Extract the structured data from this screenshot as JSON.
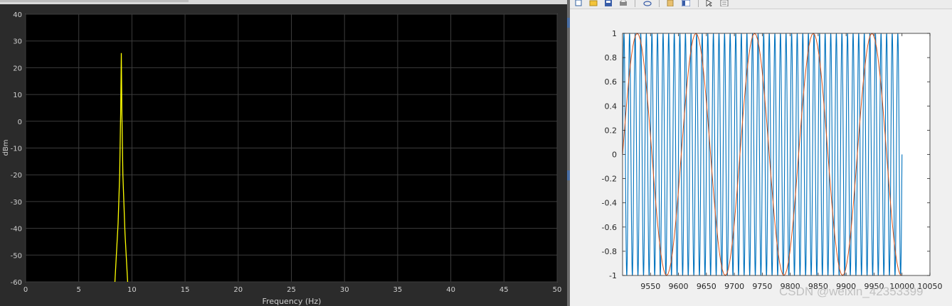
{
  "chart_data": [
    {
      "type": "line",
      "xlabel": "Frequency (Hz)",
      "ylabel": "dBm",
      "xlim": [
        0,
        50
      ],
      "ylim": [
        -60,
        40
      ],
      "xticks": [
        0,
        5,
        10,
        15,
        20,
        25,
        30,
        35,
        40,
        45,
        50
      ],
      "yticks": [
        40,
        30,
        20,
        10,
        0,
        -10,
        -20,
        -30,
        -40,
        -50,
        -60
      ],
      "grid": true,
      "background": "#000000",
      "series": [
        {
          "color": "#ffff00",
          "x": [
            8.4,
            8.7,
            8.85,
            8.95,
            9.0,
            9.05,
            9.15,
            9.35,
            9.6
          ],
          "y": [
            -60,
            -38,
            -20,
            5,
            25.5,
            5,
            -20,
            -42,
            -60
          ]
        }
      ]
    },
    {
      "type": "line",
      "xlabel": "",
      "ylabel": "",
      "xlim": [
        9500,
        10050
      ],
      "ylim": [
        -1,
        1
      ],
      "xticks": [
        9550,
        9600,
        9650,
        9700,
        9750,
        9800,
        9850,
        9900,
        9950,
        10000,
        10050
      ],
      "xtick_labels": [
        "9550",
        "9600",
        "9650",
        "9700",
        "9750",
        "9800",
        "9850",
        "9900",
        "9950",
        "10000",
        "10050"
      ],
      "yticks": [
        1,
        0.8,
        0.6,
        0.4,
        0.2,
        0,
        -0.2,
        -0.4,
        -0.6,
        -0.8,
        -1
      ],
      "ytick_labels": [
        "1",
        "0.8",
        "0.6",
        "0.4",
        "0.2",
        "0",
        "-0.2",
        "-0.4",
        "-0.6",
        "-0.8",
        "-1"
      ],
      "grid": false,
      "series": [
        {
          "color": "#0072bd",
          "kind": "sine",
          "period": 10,
          "x_start": 9500,
          "x_end": 10000
        },
        {
          "color": "#d95319",
          "kind": "sine",
          "period": 105,
          "phase_x": 9500,
          "x_start": 9500,
          "x_end": 10000
        }
      ]
    }
  ],
  "watermark": "CSDN @weixin_42353399"
}
